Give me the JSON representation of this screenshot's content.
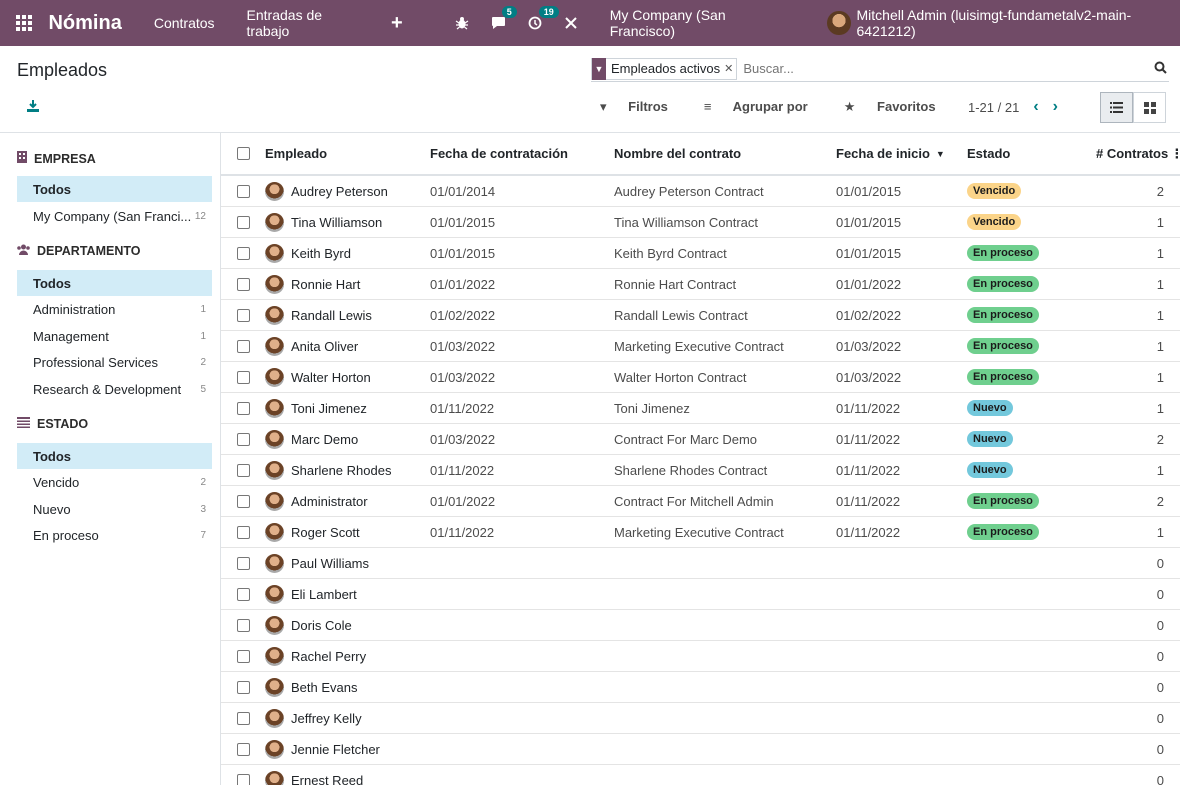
{
  "navbar": {
    "app_name": "Nómina",
    "menus": [
      "Contratos",
      "Entradas de trabajo"
    ],
    "plus": "+",
    "chat_count": "5",
    "activity_count": "19",
    "company": "My Company (San Francisco)",
    "user": "Mitchell Admin (luisimgt-fundametalv2-main-6421212)"
  },
  "control": {
    "title": "Empleados",
    "facet": "Empleados activos",
    "search_placeholder": "Buscar...",
    "filters": "Filtros",
    "group_by": "Agrupar por",
    "favorites": "Favoritos",
    "pager": "1-21 / 21"
  },
  "sidebar": {
    "groups": [
      {
        "title": "EMPRESA",
        "items": [
          {
            "label": "Todos",
            "count": ""
          },
          {
            "label": "My Company (San Franci...",
            "count": "12"
          }
        ]
      },
      {
        "title": "DEPARTAMENTO",
        "items": [
          {
            "label": "Todos",
            "count": ""
          },
          {
            "label": "Administration",
            "count": "1"
          },
          {
            "label": "Management",
            "count": "1"
          },
          {
            "label": "Professional Services",
            "count": "2"
          },
          {
            "label": "Research & Development",
            "count": "5"
          }
        ]
      },
      {
        "title": "ESTADO",
        "items": [
          {
            "label": "Todos",
            "count": ""
          },
          {
            "label": "Vencido",
            "count": "2"
          },
          {
            "label": "Nuevo",
            "count": "3"
          },
          {
            "label": "En proceso",
            "count": "7"
          }
        ]
      }
    ]
  },
  "table": {
    "headers": {
      "employee": "Empleado",
      "hire_date": "Fecha de contratación",
      "contract": "Nombre del contrato",
      "start_date": "Fecha de inicio",
      "state": "Estado",
      "contracts": "# Contratos"
    },
    "rows": [
      {
        "name": "Audrey Peterson",
        "hire": "01/01/2014",
        "contract": "Audrey Peterson Contract",
        "start": "01/01/2015",
        "state": "Vencido",
        "state_kind": "vencido",
        "count": "2"
      },
      {
        "name": "Tina Williamson",
        "hire": "01/01/2015",
        "contract": "Tina Williamson Contract",
        "start": "01/01/2015",
        "state": "Vencido",
        "state_kind": "vencido",
        "count": "1"
      },
      {
        "name": "Keith Byrd",
        "hire": "01/01/2015",
        "contract": "Keith Byrd Contract",
        "start": "01/01/2015",
        "state": "En proceso",
        "state_kind": "proceso",
        "count": "1"
      },
      {
        "name": "Ronnie Hart",
        "hire": "01/01/2022",
        "contract": "Ronnie Hart Contract",
        "start": "01/01/2022",
        "state": "En proceso",
        "state_kind": "proceso",
        "count": "1"
      },
      {
        "name": "Randall Lewis",
        "hire": "01/02/2022",
        "contract": "Randall Lewis Contract",
        "start": "01/02/2022",
        "state": "En proceso",
        "state_kind": "proceso",
        "count": "1"
      },
      {
        "name": "Anita Oliver",
        "hire": "01/03/2022",
        "contract": "Marketing Executive Contract",
        "start": "01/03/2022",
        "state": "En proceso",
        "state_kind": "proceso",
        "count": "1"
      },
      {
        "name": "Walter Horton",
        "hire": "01/03/2022",
        "contract": "Walter Horton Contract",
        "start": "01/03/2022",
        "state": "En proceso",
        "state_kind": "proceso",
        "count": "1"
      },
      {
        "name": "Toni Jimenez",
        "hire": "01/11/2022",
        "contract": "Toni Jimenez",
        "start": "01/11/2022",
        "state": "Nuevo",
        "state_kind": "nuevo",
        "count": "1"
      },
      {
        "name": "Marc Demo",
        "hire": "01/03/2022",
        "contract": "Contract For Marc Demo",
        "start": "01/11/2022",
        "state": "Nuevo",
        "state_kind": "nuevo",
        "count": "2"
      },
      {
        "name": "Sharlene Rhodes",
        "hire": "01/11/2022",
        "contract": "Sharlene Rhodes Contract",
        "start": "01/11/2022",
        "state": "Nuevo",
        "state_kind": "nuevo",
        "count": "1"
      },
      {
        "name": "Administrator",
        "hire": "01/01/2022",
        "contract": "Contract For Mitchell Admin",
        "start": "01/11/2022",
        "state": "En proceso",
        "state_kind": "proceso",
        "count": "2"
      },
      {
        "name": "Roger Scott",
        "hire": "01/11/2022",
        "contract": "Marketing Executive Contract",
        "start": "01/11/2022",
        "state": "En proceso",
        "state_kind": "proceso",
        "count": "1"
      },
      {
        "name": "Paul Williams",
        "hire": "",
        "contract": "",
        "start": "",
        "state": "",
        "state_kind": "",
        "count": "0"
      },
      {
        "name": "Eli Lambert",
        "hire": "",
        "contract": "",
        "start": "",
        "state": "",
        "state_kind": "",
        "count": "0"
      },
      {
        "name": "Doris Cole",
        "hire": "",
        "contract": "",
        "start": "",
        "state": "",
        "state_kind": "",
        "count": "0"
      },
      {
        "name": "Rachel Perry",
        "hire": "",
        "contract": "",
        "start": "",
        "state": "",
        "state_kind": "",
        "count": "0"
      },
      {
        "name": "Beth Evans",
        "hire": "",
        "contract": "",
        "start": "",
        "state": "",
        "state_kind": "",
        "count": "0"
      },
      {
        "name": "Jeffrey Kelly",
        "hire": "",
        "contract": "",
        "start": "",
        "state": "",
        "state_kind": "",
        "count": "0"
      },
      {
        "name": "Jennie Fletcher",
        "hire": "",
        "contract": "",
        "start": "",
        "state": "",
        "state_kind": "",
        "count": "0"
      },
      {
        "name": "Ernest Reed",
        "hire": "",
        "contract": "",
        "start": "",
        "state": "",
        "state_kind": "",
        "count": "0"
      }
    ]
  }
}
